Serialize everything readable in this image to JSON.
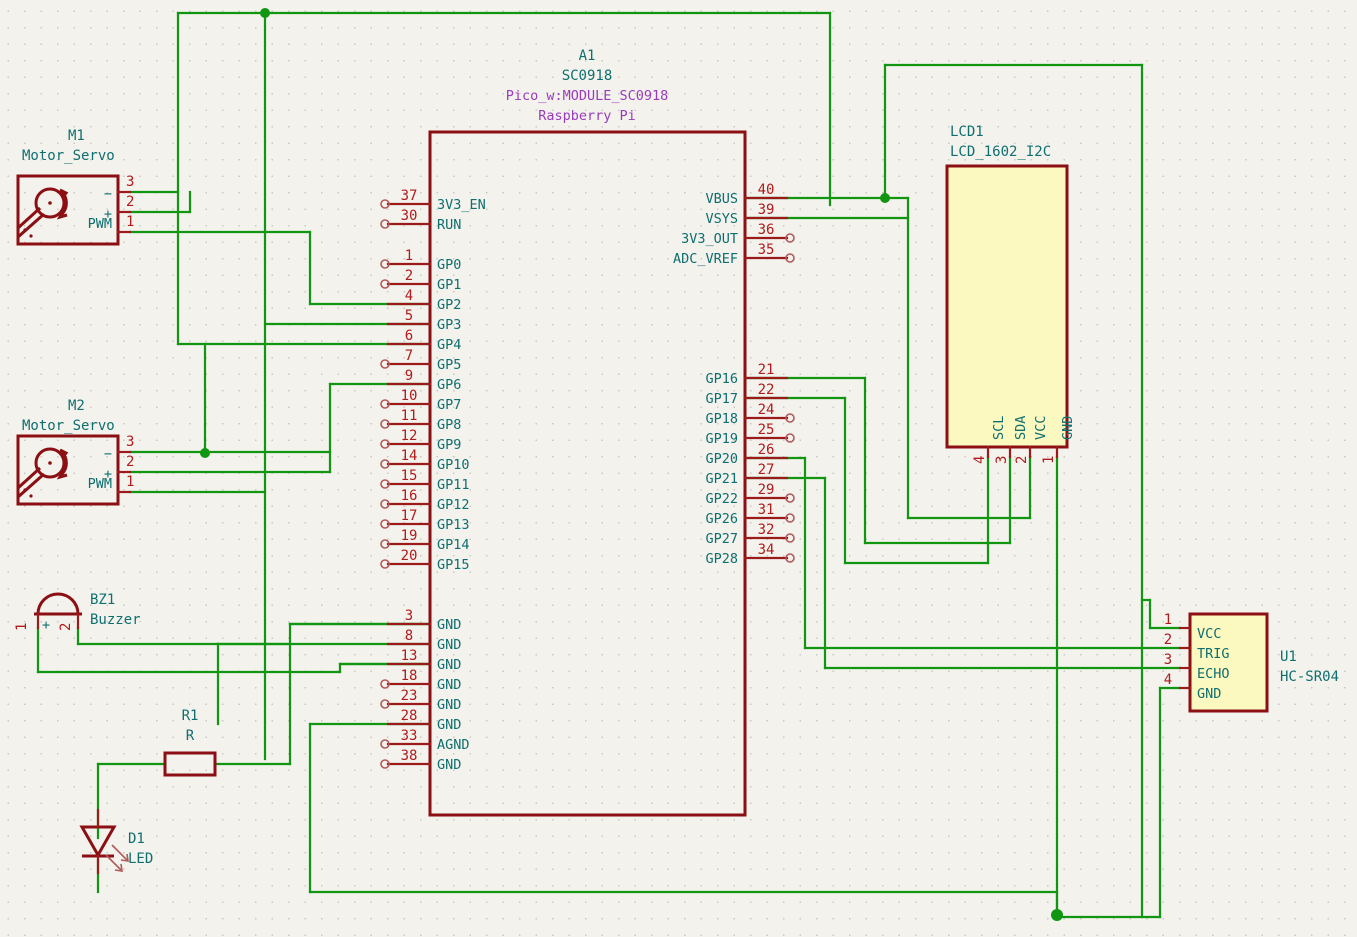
{
  "document": {
    "type": "kicad-schematic",
    "title": "Raspberry Pi Pico W robot schematic"
  },
  "components": {
    "A1": {
      "ref": "A1",
      "value": "SC0918",
      "footprint": "Pico_w:MODULE_SC0918",
      "manufacturer": "Raspberry Pi",
      "left_pins": [
        {
          "num": "37",
          "name": "3V3_EN",
          "connected": false
        },
        {
          "num": "30",
          "name": "RUN",
          "connected": false
        },
        {
          "num": "1",
          "name": "GP0",
          "connected": false
        },
        {
          "num": "2",
          "name": "GP1",
          "connected": false
        },
        {
          "num": "4",
          "name": "GP2",
          "connected": true
        },
        {
          "num": "5",
          "name": "GP3",
          "connected": true
        },
        {
          "num": "6",
          "name": "GP4",
          "connected": true
        },
        {
          "num": "7",
          "name": "GP5",
          "connected": false
        },
        {
          "num": "9",
          "name": "GP6",
          "connected": true
        },
        {
          "num": "10",
          "name": "GP7",
          "connected": false
        },
        {
          "num": "11",
          "name": "GP8",
          "connected": false
        },
        {
          "num": "12",
          "name": "GP9",
          "connected": false
        },
        {
          "num": "14",
          "name": "GP10",
          "connected": false
        },
        {
          "num": "15",
          "name": "GP11",
          "connected": false
        },
        {
          "num": "16",
          "name": "GP12",
          "connected": false
        },
        {
          "num": "17",
          "name": "GP13",
          "connected": false
        },
        {
          "num": "19",
          "name": "GP14",
          "connected": false
        },
        {
          "num": "20",
          "name": "GP15",
          "connected": false
        },
        {
          "num": "3",
          "name": "GND",
          "connected": true
        },
        {
          "num": "8",
          "name": "GND",
          "connected": true
        },
        {
          "num": "13",
          "name": "GND",
          "connected": true
        },
        {
          "num": "18",
          "name": "GND",
          "connected": false
        },
        {
          "num": "23",
          "name": "GND",
          "connected": false
        },
        {
          "num": "28",
          "name": "GND",
          "connected": true
        },
        {
          "num": "33",
          "name": "AGND",
          "connected": false
        },
        {
          "num": "38",
          "name": "GND",
          "connected": false
        }
      ],
      "right_pins": [
        {
          "num": "40",
          "name": "VBUS",
          "connected": true
        },
        {
          "num": "39",
          "name": "VSYS",
          "connected": true
        },
        {
          "num": "36",
          "name": "3V3_OUT",
          "connected": false
        },
        {
          "num": "35",
          "name": "ADC_VREF",
          "connected": false
        },
        {
          "num": "21",
          "name": "GP16",
          "connected": true
        },
        {
          "num": "22",
          "name": "GP17",
          "connected": true
        },
        {
          "num": "24",
          "name": "GP18",
          "connected": false
        },
        {
          "num": "25",
          "name": "GP19",
          "connected": false
        },
        {
          "num": "26",
          "name": "GP20",
          "connected": true
        },
        {
          "num": "27",
          "name": "GP21",
          "connected": true
        },
        {
          "num": "29",
          "name": "GP22",
          "connected": false
        },
        {
          "num": "31",
          "name": "GP26",
          "connected": false
        },
        {
          "num": "32",
          "name": "GP27",
          "connected": false
        },
        {
          "num": "34",
          "name": "GP28",
          "connected": false
        }
      ]
    },
    "M1": {
      "ref": "M1",
      "value": "Motor_Servo",
      "pins": [
        {
          "num": "3",
          "name": "−"
        },
        {
          "num": "2",
          "name": "+"
        },
        {
          "num": "1",
          "name": "PWM"
        }
      ]
    },
    "M2": {
      "ref": "M2",
      "value": "Motor_Servo",
      "pins": [
        {
          "num": "3",
          "name": "−"
        },
        {
          "num": "2",
          "name": "+"
        },
        {
          "num": "1",
          "name": "PWM"
        }
      ]
    },
    "BZ1": {
      "ref": "BZ1",
      "value": "Buzzer",
      "pins": [
        {
          "num": "1",
          "name": "+"
        },
        {
          "num": "2",
          "name": ""
        }
      ]
    },
    "R1": {
      "ref": "R1",
      "value": "R"
    },
    "D1": {
      "ref": "D1",
      "value": "LED"
    },
    "LCD1": {
      "ref": "LCD1",
      "value": "LCD_1602_I2C",
      "pins": [
        {
          "num": "4",
          "name": "SCL"
        },
        {
          "num": "3",
          "name": "SDA"
        },
        {
          "num": "2",
          "name": "VCC"
        },
        {
          "num": "1",
          "name": "GND"
        }
      ]
    },
    "U1": {
      "ref": "U1",
      "value": "HC-SR04",
      "pins": [
        {
          "num": "1",
          "name": "VCC"
        },
        {
          "num": "2",
          "name": "TRIG"
        },
        {
          "num": "3",
          "name": "ECHO"
        },
        {
          "num": "4",
          "name": "GND"
        }
      ]
    }
  },
  "colors": {
    "wire": "#119611",
    "component_outline": "#8b0f13",
    "pin_number": "#b11b1b",
    "pin_name": "#0f6f6f",
    "reference": "#0f6f6f",
    "field": "#9a3bbd",
    "lcd_fill": "#fbf8c0",
    "background": "#f3f2ed"
  }
}
